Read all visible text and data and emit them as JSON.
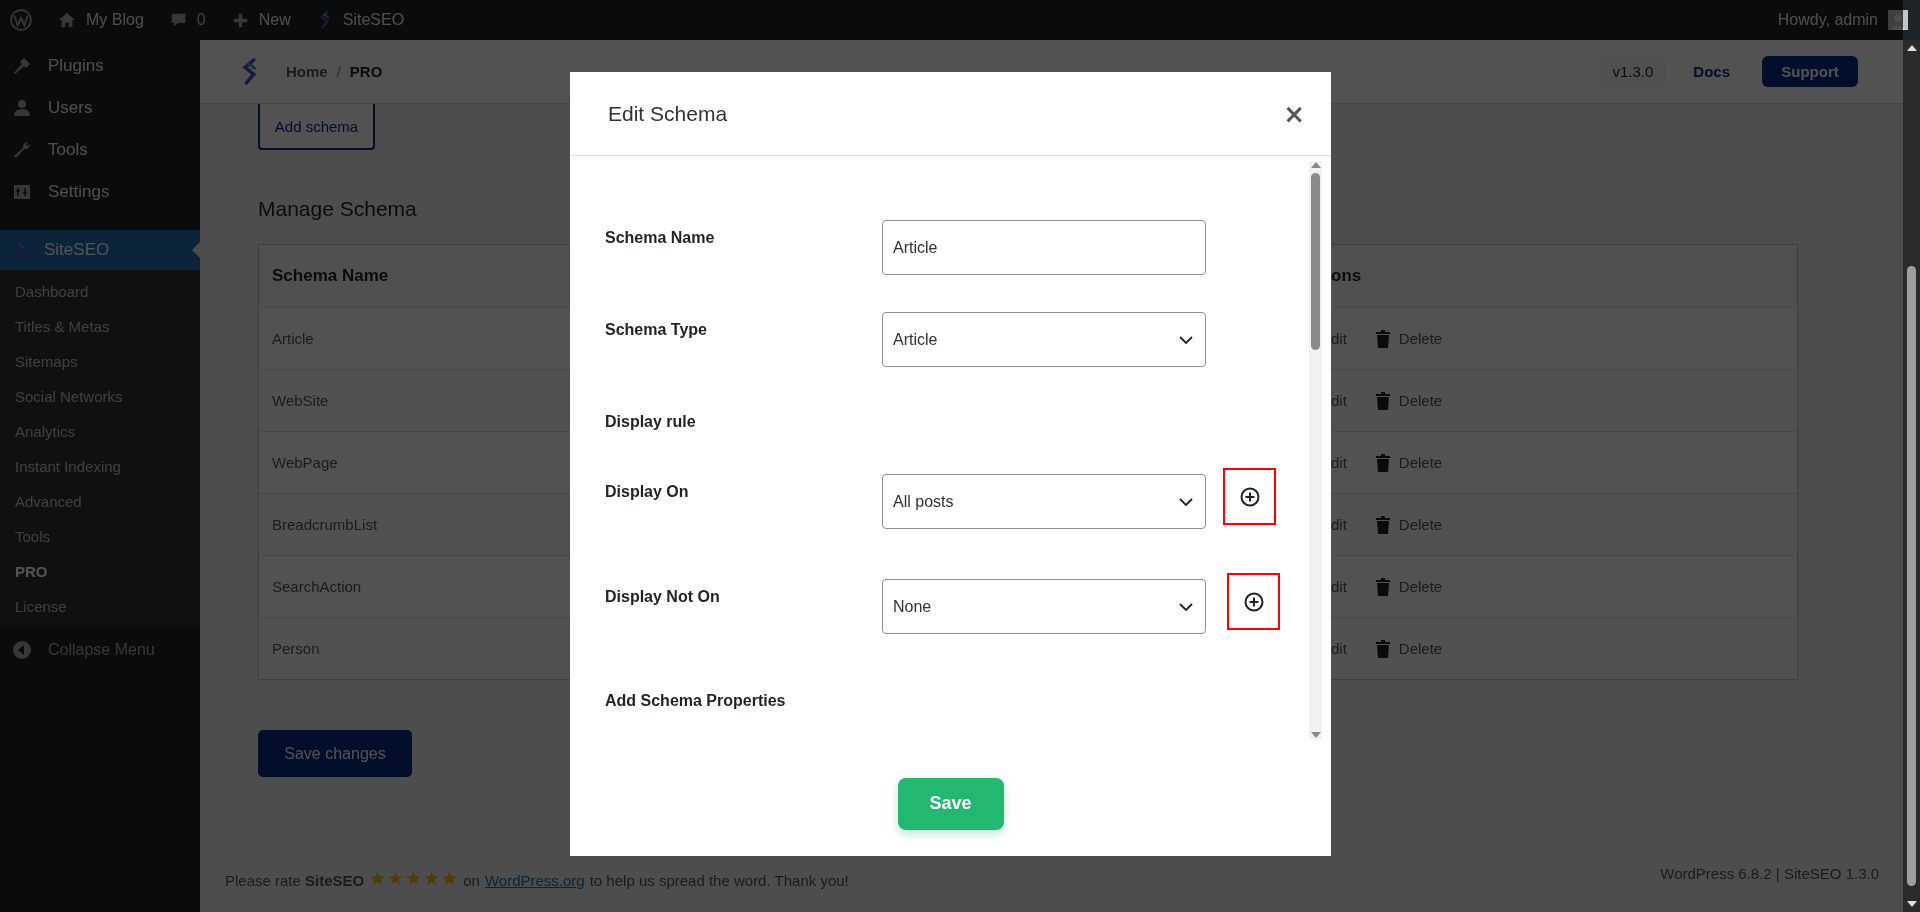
{
  "admin_bar": {
    "site": "My Blog",
    "comments": "0",
    "new": "New",
    "plugin": "SiteSEO",
    "greeting": "Howdy, admin"
  },
  "sidebar": {
    "items": [
      {
        "label": "Plugins",
        "selected": false
      },
      {
        "label": "Users",
        "selected": false
      },
      {
        "label": "Tools",
        "selected": false
      },
      {
        "label": "Settings",
        "selected": false
      },
      {
        "label": "SiteSEO",
        "selected": true
      }
    ],
    "submenu": [
      {
        "label": "Dashboard",
        "selected": false
      },
      {
        "label": "Titles & Metas",
        "selected": false
      },
      {
        "label": "Sitemaps",
        "selected": false
      },
      {
        "label": "Social Networks",
        "selected": false
      },
      {
        "label": "Analytics",
        "selected": false
      },
      {
        "label": "Instant Indexing",
        "selected": false
      },
      {
        "label": "Advanced",
        "selected": false
      },
      {
        "label": "Tools",
        "selected": false
      },
      {
        "label": "PRO",
        "selected": true
      },
      {
        "label": "License",
        "selected": false
      }
    ],
    "collapse": "Collapse Menu"
  },
  "header": {
    "breadcrumb": [
      "Home",
      "PRO"
    ],
    "separator": "/",
    "version": "v1.3.0",
    "docs": "Docs",
    "support": "Support"
  },
  "content": {
    "add_button": "Add schema",
    "heading": "Manage Schema",
    "table": {
      "columns": [
        "Schema Name",
        "ons"
      ],
      "rows": [
        {
          "name": "Article",
          "edit": "dit",
          "delete": "Delete"
        },
        {
          "name": "WebSite",
          "edit": "dit",
          "delete": "Delete"
        },
        {
          "name": "WebPage",
          "edit": "dit",
          "delete": "Delete"
        },
        {
          "name": "BreadcrumbList",
          "edit": "dit",
          "delete": "Delete"
        },
        {
          "name": "SearchAction",
          "edit": "dit",
          "delete": "Delete"
        },
        {
          "name": "Person",
          "edit": "dit",
          "delete": "Delete"
        }
      ]
    },
    "save": "Save changes"
  },
  "footer": {
    "rate": "Please rate **SiteSEO**",
    "stars": 5,
    "on": "on",
    "link": "WordPress.org",
    "thanks": "to help us spread the word. Thank you!",
    "version": "WordPress 6.8.2 | SiteSEO 1.3.0"
  },
  "modal": {
    "title": "Edit Schema",
    "close": "×",
    "rows": [
      {
        "kind": "text",
        "label": "Schema Name",
        "value": "Article"
      },
      {
        "kind": "select",
        "label": "Schema Type",
        "value": "Article"
      },
      {
        "kind": "heading",
        "label": "Display rule"
      },
      {
        "kind": "select",
        "label": "Display On",
        "value": "All posts",
        "add": true,
        "highlighted": true
      },
      {
        "kind": "select",
        "label": "Display Not On",
        "value": "None",
        "add": true,
        "highlighted": true
      },
      {
        "kind": "heading",
        "label": "Add Schema Properties"
      }
    ],
    "save": "Save"
  }
}
